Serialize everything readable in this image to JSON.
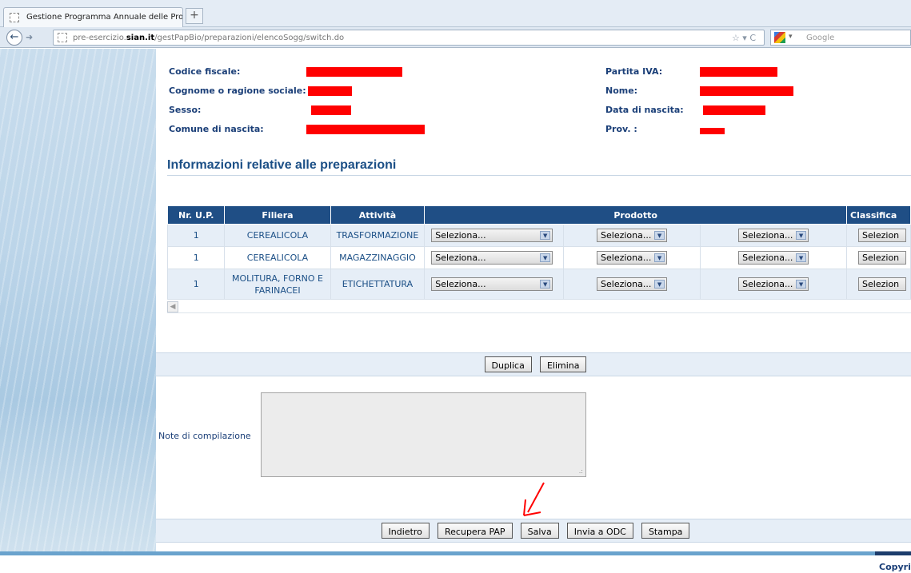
{
  "browser": {
    "tab_title": "Gestione Programma Annuale delle Produzio...",
    "new_tab": "+",
    "url_prefix": "pre-esercizio.",
    "url_domain": "sian.it",
    "url_path": "/gestPapBio/preparazioni/elencoSogg/switch.do",
    "search_placeholder": "Google"
  },
  "subject": {
    "codice_fiscale_label": "Codice fiscale:",
    "cognome_label": "Cognome o ragione sociale:",
    "sesso_label": "Sesso:",
    "comune_label": "Comune di nascita:",
    "partita_iva_label": "Partita IVA:",
    "nome_label": "Nome:",
    "data_nascita_label": "Data di nascita:",
    "prov_label": "Prov. :"
  },
  "section_title": "Informazioni relative alle preparazioni",
  "table": {
    "headers": [
      "Nr. U.P.",
      "Filiera",
      "Attività",
      "Prodotto",
      "Classifica"
    ],
    "rows": [
      {
        "nr": "1",
        "filiera": "CEREALICOLA",
        "attivita": "TRASFORMAZIONE",
        "sel1": "Seleziona...",
        "sel2": "Seleziona...",
        "sel3": "Seleziona...",
        "sel4": "Selezion"
      },
      {
        "nr": "1",
        "filiera": "CEREALICOLA",
        "attivita": "MAGAZZINAGGIO",
        "sel1": "Seleziona...",
        "sel2": "Seleziona...",
        "sel3": "Seleziona...",
        "sel4": "Selezion"
      },
      {
        "nr": "1",
        "filiera": "MOLITURA, FORNO E FARINACEI",
        "attivita": "ETICHETTATURA",
        "sel1": "Seleziona...",
        "sel2": "Seleziona...",
        "sel3": "Seleziona...",
        "sel4": "Selezion"
      }
    ]
  },
  "row_actions": {
    "duplica": "Duplica",
    "elimina": "Elimina"
  },
  "notes": {
    "label": "Note di compilazione",
    "value": ""
  },
  "footer_actions": {
    "indietro": "Indietro",
    "recupera": "Recupera PAP",
    "salva": "Salva",
    "invia": "Invia a ODC",
    "stampa": "Stampa"
  },
  "copyright": "Copyri",
  "colors": {
    "header_blue": "#1f4e85",
    "annotation_red": "#ff0000",
    "row_alt": "#e6eef7"
  }
}
